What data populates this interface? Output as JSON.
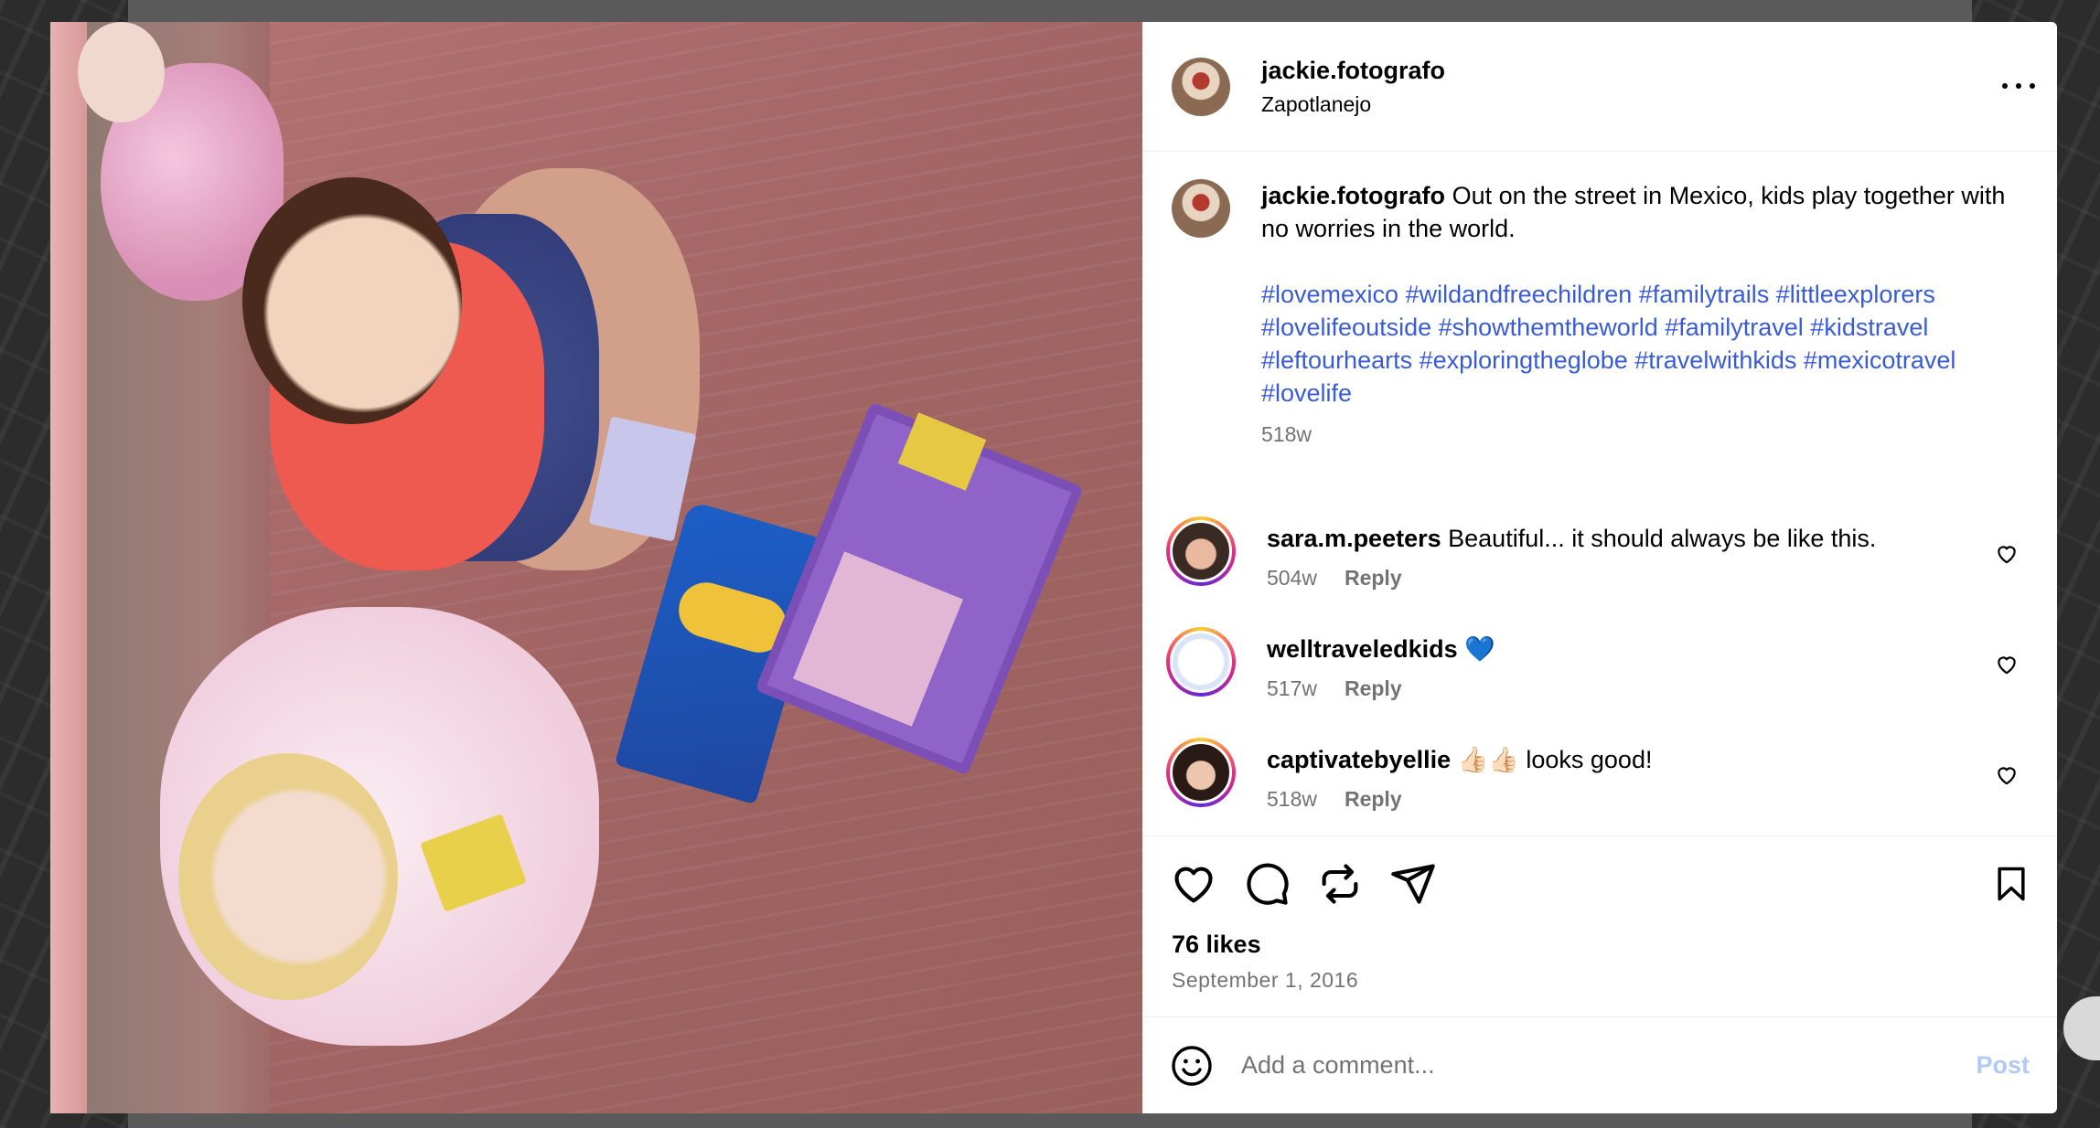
{
  "post": {
    "username": "jackie.fotografo",
    "location": "Zapotlanejo",
    "caption_text": "Out on the street in Mexico, kids play together with no worries in the world.",
    "hashtags": "#lovemexico #wildandfreechildren #familytrails #littleexplorers #lovelifeoutside #showthemtheworld #familytravel #kidstravel #leftourhearts #exploringtheglobe #travelwithkids #mexicotravel #lovelife",
    "caption_age": "518w",
    "likes": "76 likes",
    "date": "September 1, 2016"
  },
  "comments": [
    {
      "user": "sara.m.peeters",
      "text": "Beautiful... it should always be like this.",
      "age": "504w",
      "reply_label": "Reply"
    },
    {
      "user": "welltraveledkids",
      "text": "💙",
      "age": "517w",
      "reply_label": "Reply"
    },
    {
      "user": "captivatebyellie",
      "text": "👍🏻👍🏻 looks good!",
      "age": "518w",
      "reply_label": "Reply"
    }
  ],
  "composer": {
    "placeholder": "Add a comment...",
    "post_label": "Post"
  },
  "icons": {
    "more": "more-options-icon",
    "like": "heart-icon",
    "comment": "comment-bubble-icon",
    "repost": "repost-icon",
    "share": "send-icon",
    "save": "bookmark-icon",
    "emoji": "emoji-icon"
  },
  "colors": {
    "hashtag": "#3a5bd9",
    "muted": "#737373",
    "post_disabled": "#b2c9f6"
  }
}
